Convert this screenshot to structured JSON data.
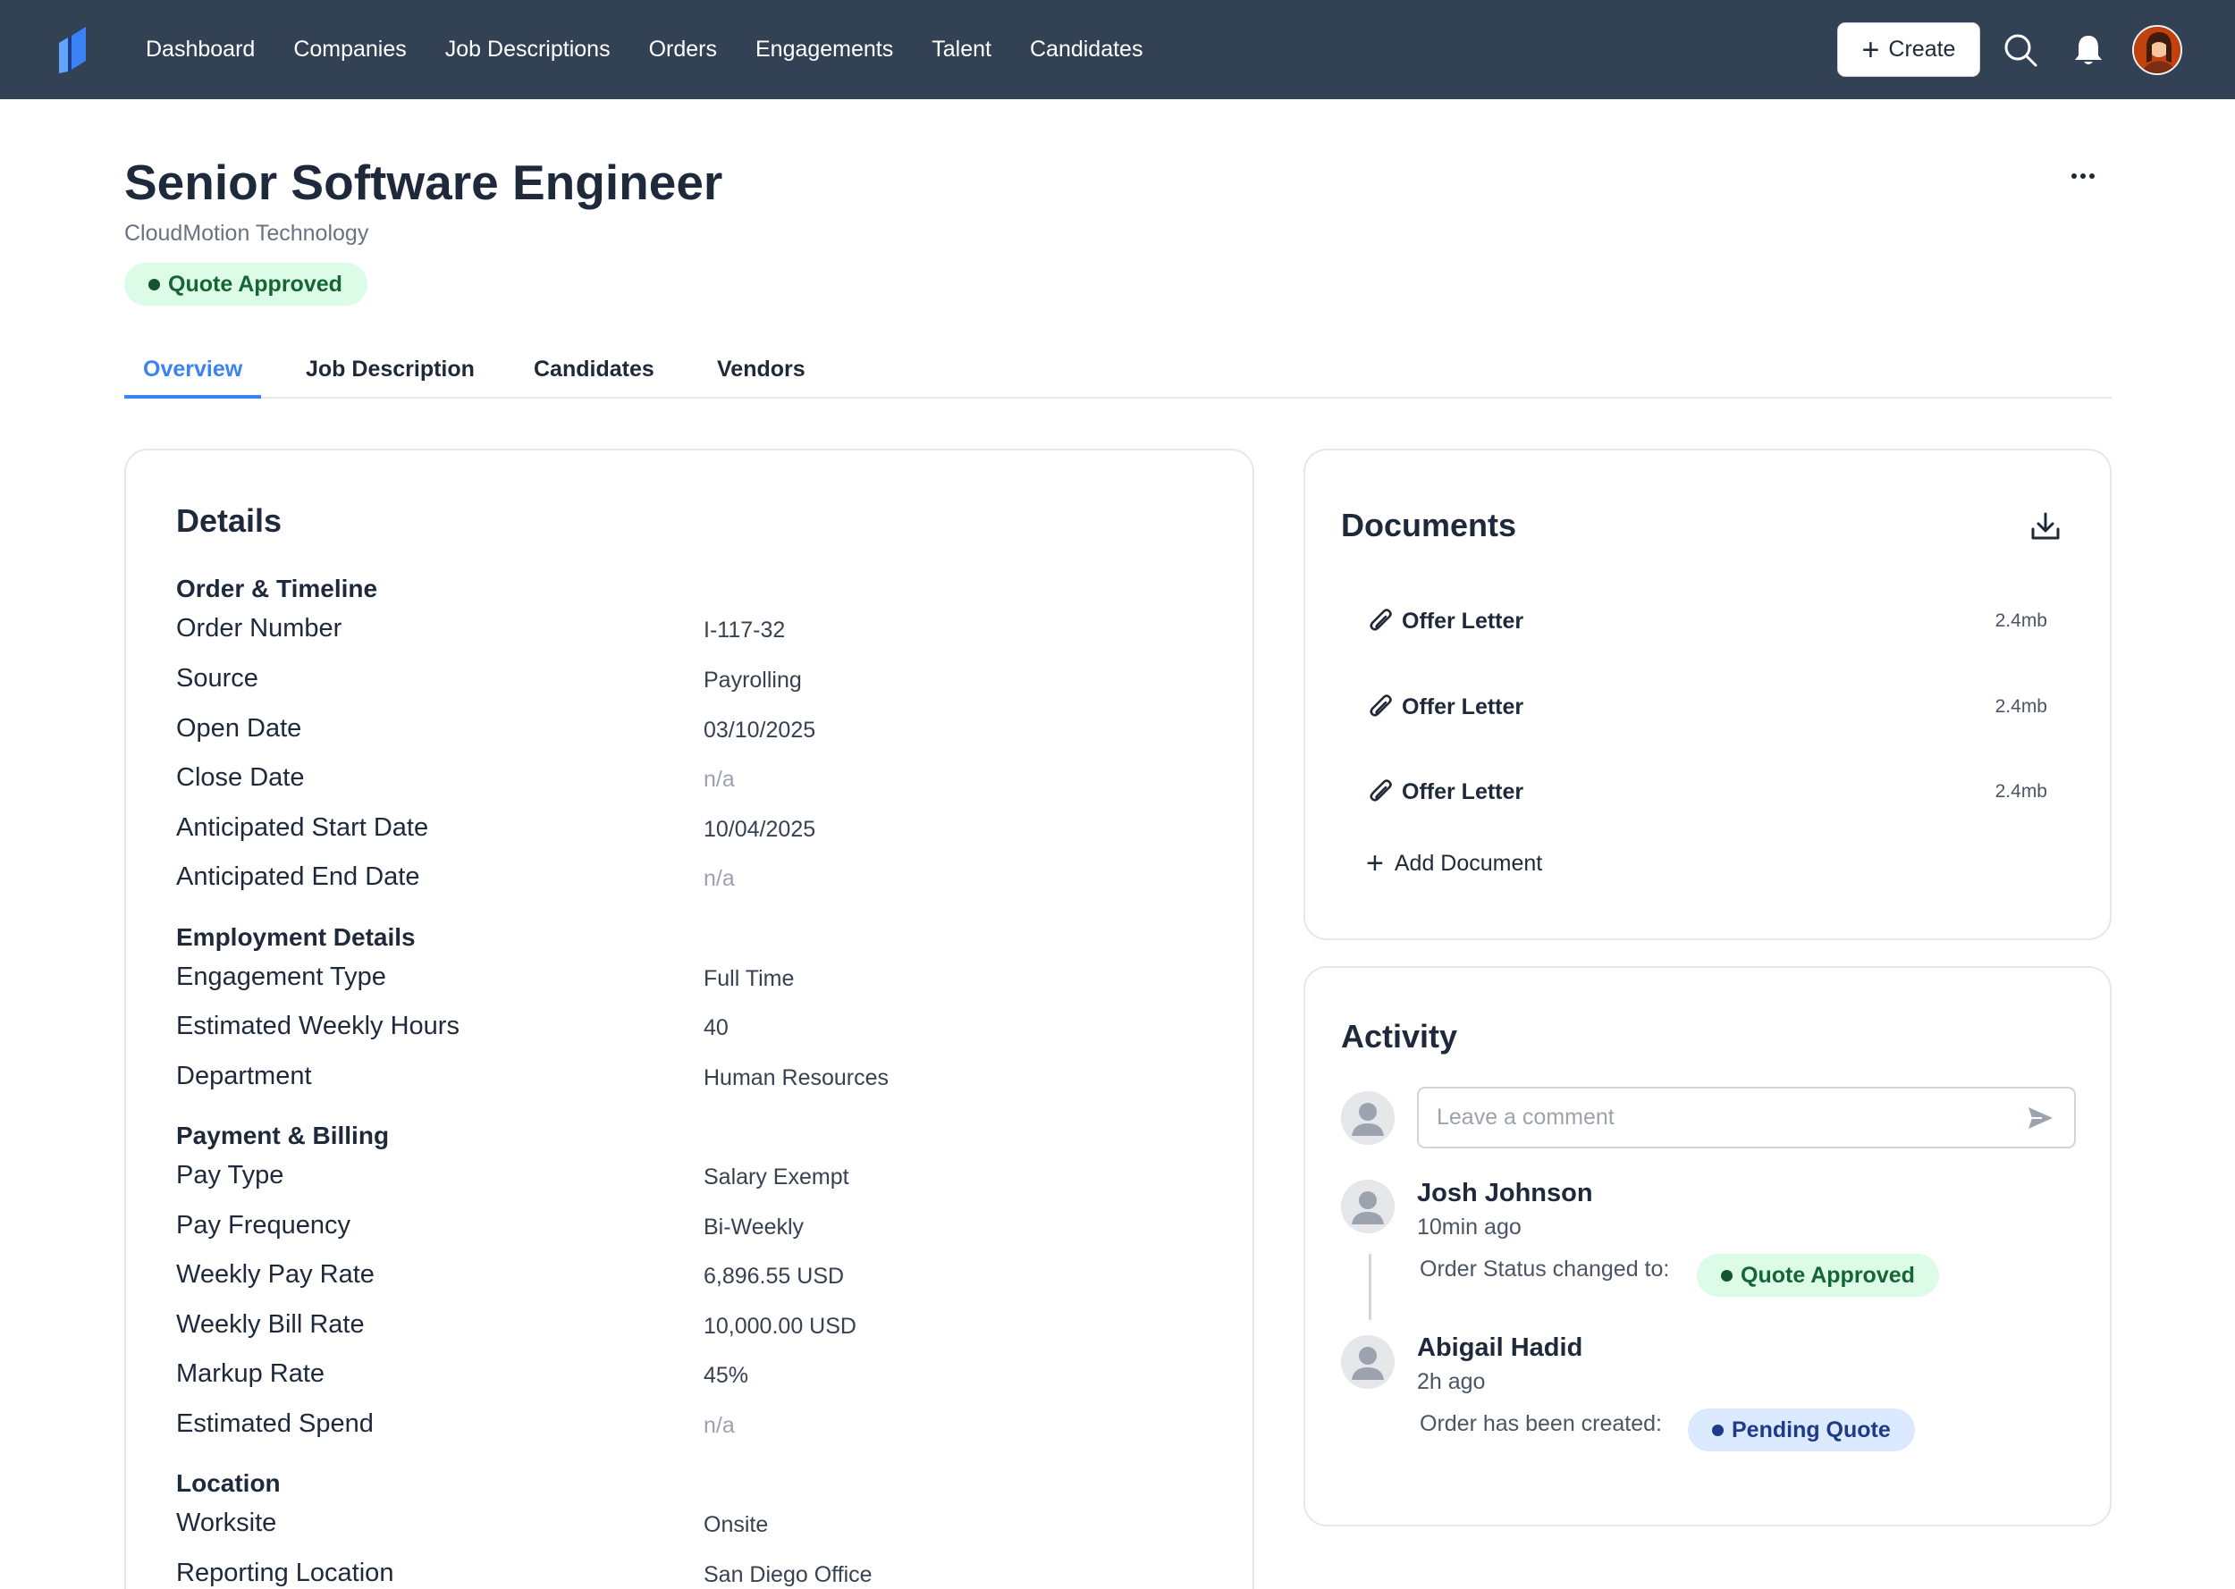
{
  "nav": {
    "items": [
      "Dashboard",
      "Companies",
      "Job Descriptions",
      "Orders",
      "Engagements",
      "Talent",
      "Candidates"
    ],
    "create_label": "Create",
    "brand_color": "#334155"
  },
  "header": {
    "title": "Senior Software Engineer",
    "company": "CloudMotion Technology",
    "status": "Quote Approved"
  },
  "tabs": [
    "Overview",
    "Job Description",
    "Candidates",
    "Vendors"
  ],
  "active_tab": "Overview",
  "details": {
    "title": "Details",
    "sections": {
      "order_timeline": {
        "title": "Order & Timeline",
        "fields": [
          {
            "label": "Order Number",
            "value": "I-117-32"
          },
          {
            "label": "Source",
            "value": "Payrolling"
          },
          {
            "label": "Open Date",
            "value": "03/10/2025"
          },
          {
            "label": "Close Date",
            "value": "n/a"
          },
          {
            "label": "Anticipated Start Date",
            "value": "10/04/2025"
          },
          {
            "label": "Anticipated End Date",
            "value": "n/a"
          }
        ]
      },
      "employment": {
        "title": "Employment Details",
        "fields": [
          {
            "label": "Engagement Type",
            "value": "Full Time"
          },
          {
            "label": "Estimated Weekly Hours",
            "value": "40"
          },
          {
            "label": "Department",
            "value": "Human Resources"
          }
        ]
      },
      "payment": {
        "title": "Payment & Billing",
        "fields": [
          {
            "label": "Pay Type",
            "value": "Salary Exempt"
          },
          {
            "label": "Pay Frequency",
            "value": "Bi-Weekly"
          },
          {
            "label": "Weekly Pay Rate",
            "value": "6,896.55 USD"
          },
          {
            "label": "Weekly Bill Rate",
            "value": "10,000.00 USD"
          },
          {
            "label": "Markup Rate",
            "value": "45%"
          },
          {
            "label": "Estimated Spend",
            "value": "n/a"
          }
        ]
      },
      "location": {
        "title": "Location",
        "fields": [
          {
            "label": "Worksite",
            "value": "Onsite"
          },
          {
            "label": "Reporting Location",
            "value": "San Diego Office"
          }
        ]
      }
    }
  },
  "documents": {
    "title": "Documents",
    "items": [
      {
        "name": "Offer Letter",
        "size": "2.4mb"
      },
      {
        "name": "Offer Letter",
        "size": "2.4mb"
      },
      {
        "name": "Offer Letter",
        "size": "2.4mb"
      }
    ],
    "add_label": "Add Document"
  },
  "activity": {
    "title": "Activity",
    "comment_placeholder": "Leave a comment",
    "entries": [
      {
        "user": "Josh Johnson",
        "time": "10min ago",
        "text": "Order Status changed to:",
        "status": "Quote Approved"
      },
      {
        "user": "Abigail Hadid",
        "time": "2h ago",
        "text": "Order has been created:",
        "status": "Pending Quote"
      }
    ]
  },
  "colors": {
    "accent": "#3b82f6",
    "approved_bg": "#dcfce7",
    "approved_text": "#166534",
    "pending_bg": "#dbeafe",
    "pending_text": "#1e3a8a"
  }
}
